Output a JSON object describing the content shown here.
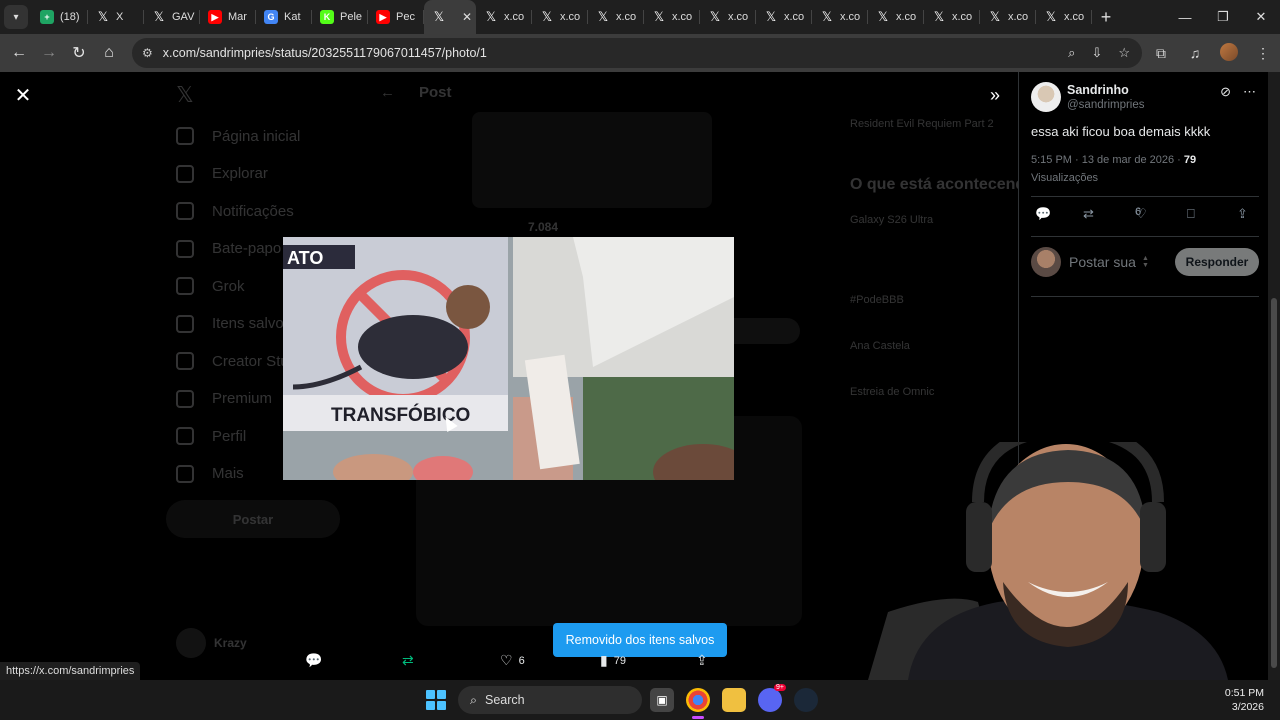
{
  "browser": {
    "tab_count_badge": "(18)",
    "tabs": [
      {
        "label": "(18)",
        "favicon": "sheets",
        "color": "#1fa463"
      },
      {
        "label": "X",
        "favicon": "x-logo",
        "color": "#ffffff"
      },
      {
        "label": "GAV",
        "favicon": "x-logo",
        "color": "#ffffff"
      },
      {
        "label": "Mar",
        "favicon": "youtube",
        "color": "#ff0000"
      },
      {
        "label": "Kat",
        "favicon": "google",
        "color": "#4285f4"
      },
      {
        "label": "Pele",
        "favicon": "kick",
        "color": "#53fc18"
      },
      {
        "label": "Pec",
        "favicon": "youtube",
        "color": "#ff0000"
      },
      {
        "label": "",
        "favicon": "x-logo",
        "color": "#ffffff",
        "active": true
      },
      {
        "label": "x.co",
        "favicon": "x-logo",
        "color": "#ffffff"
      },
      {
        "label": "x.co",
        "favicon": "x-logo",
        "color": "#ffffff"
      },
      {
        "label": "x.co",
        "favicon": "x-logo",
        "color": "#ffffff"
      },
      {
        "label": "x.co",
        "favicon": "x-logo",
        "color": "#ffffff"
      },
      {
        "label": "x.co",
        "favicon": "x-logo",
        "color": "#ffffff"
      },
      {
        "label": "x.co",
        "favicon": "x-logo",
        "color": "#ffffff"
      },
      {
        "label": "x.co",
        "favicon": "x-logo",
        "color": "#ffffff"
      },
      {
        "label": "x.co",
        "favicon": "x-logo",
        "color": "#ffffff"
      },
      {
        "label": "x.co",
        "favicon": "x-logo",
        "color": "#ffffff"
      },
      {
        "label": "x.co",
        "favicon": "x-logo",
        "color": "#ffffff"
      },
      {
        "label": "x.co",
        "favicon": "x-logo",
        "color": "#ffffff"
      }
    ],
    "url": "x.com/sandrimpries/status/2032551179067011457/photo/1",
    "status_url": "https://x.com/sandrimpries"
  },
  "background_page": {
    "nav": [
      "Página inicial",
      "Explorar",
      "Notificações",
      "Bate-papo",
      "Grok",
      "Itens salvos",
      "Creator Studio",
      "Premium",
      "Perfil",
      "Mais"
    ],
    "post_button": "Postar",
    "header": "Post",
    "views_short": "7.084",
    "trend_heading": "O que está acontecendo",
    "trends": [
      "Resident Evil Requiem Part 2",
      "Galaxy S26 Ultra",
      "#PodeBBB",
      "Ana Castela",
      "Estreia de Omnic"
    ],
    "bottom_user": "Krazy"
  },
  "image": {
    "sign_top": "ATO",
    "sign_caption": "TRANSFÓBICO"
  },
  "viewer_actions": {
    "likes": "6",
    "views": "79"
  },
  "toast": "Removido dos itens salvos",
  "side_panel": {
    "author_name": "Sandrinho",
    "author_handle": "@sandrimpries",
    "tweet_text": "essa aki ficou boa demais kkkk",
    "timestamp": "5:15 PM · 13 de mar de 2026 · ",
    "views_count": "79",
    "views_label": "Visualizações",
    "likes": "6",
    "reply_placeholder": "Postar sua",
    "reply_button": "Responder"
  },
  "taskbar": {
    "search_label": "Search",
    "time": "0:51 PM",
    "date": "3/2026",
    "discord_badge": "9+"
  }
}
